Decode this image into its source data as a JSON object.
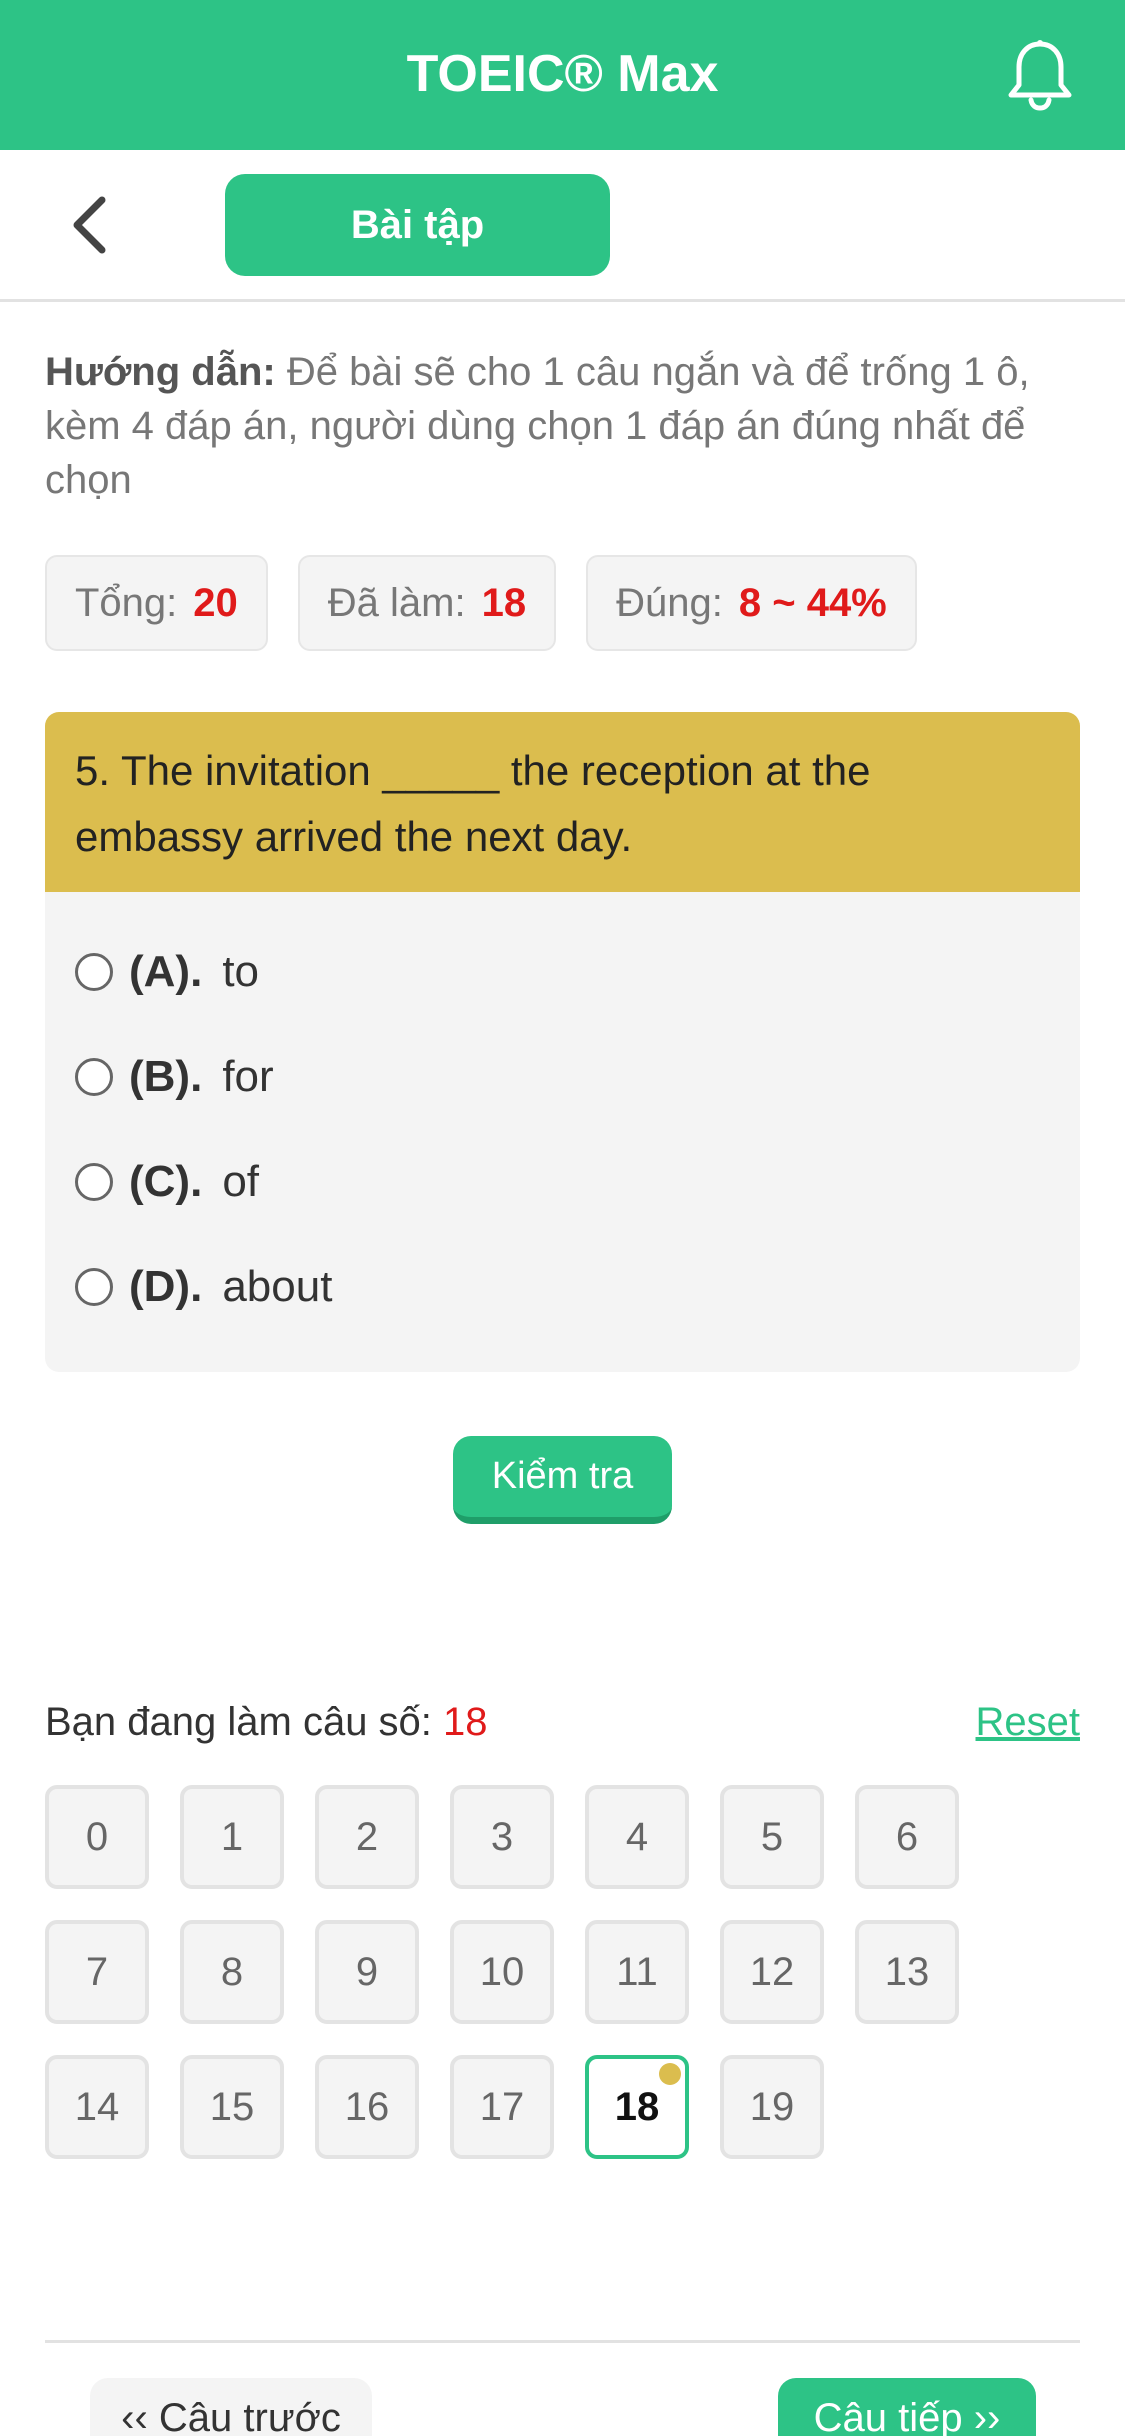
{
  "header": {
    "title": "TOEIC® Max",
    "bell_icon": "bell-icon",
    "bg_color": "#2dc386"
  },
  "subheader": {
    "back_icon": "chevron-left-icon",
    "tab_label": "Bài tập"
  },
  "guide": {
    "label": "Hướng dẫn:",
    "text": " Để bài sẽ cho 1 câu ngắn và để trống 1 ô, kèm 4 đáp án, người dùng chọn 1 đáp án đúng nhất để chọn"
  },
  "stats": {
    "total_label": "Tổng:",
    "total_value": "20",
    "done_label": "Đã làm:",
    "done_value": "18",
    "correct_label": "Đúng:",
    "correct_value": "8 ~ 44%"
  },
  "question": {
    "text": "5. The invitation _____ the reception at the embassy arrived the next day.",
    "options": [
      {
        "letter": "(A).",
        "text": "to"
      },
      {
        "letter": "(B).",
        "text": "for"
      },
      {
        "letter": "(C).",
        "text": "of"
      },
      {
        "letter": "(D).",
        "text": "about"
      }
    ]
  },
  "check_button": "Kiểm tra",
  "progress": {
    "label": "Bạn đang làm câu số:",
    "current": "18",
    "reset_label": "Reset",
    "numbers": [
      "0",
      "1",
      "2",
      "3",
      "4",
      "5",
      "6",
      "7",
      "8",
      "9",
      "10",
      "11",
      "12",
      "13",
      "14",
      "15",
      "16",
      "17",
      "18",
      "19"
    ]
  },
  "nav": {
    "prev": "‹‹ Câu trước",
    "next": "Câu tiếp ››"
  },
  "colors": {
    "accent": "#2dc386",
    "question_bg": "#dbbd4e",
    "highlight": "#e01a1a"
  }
}
